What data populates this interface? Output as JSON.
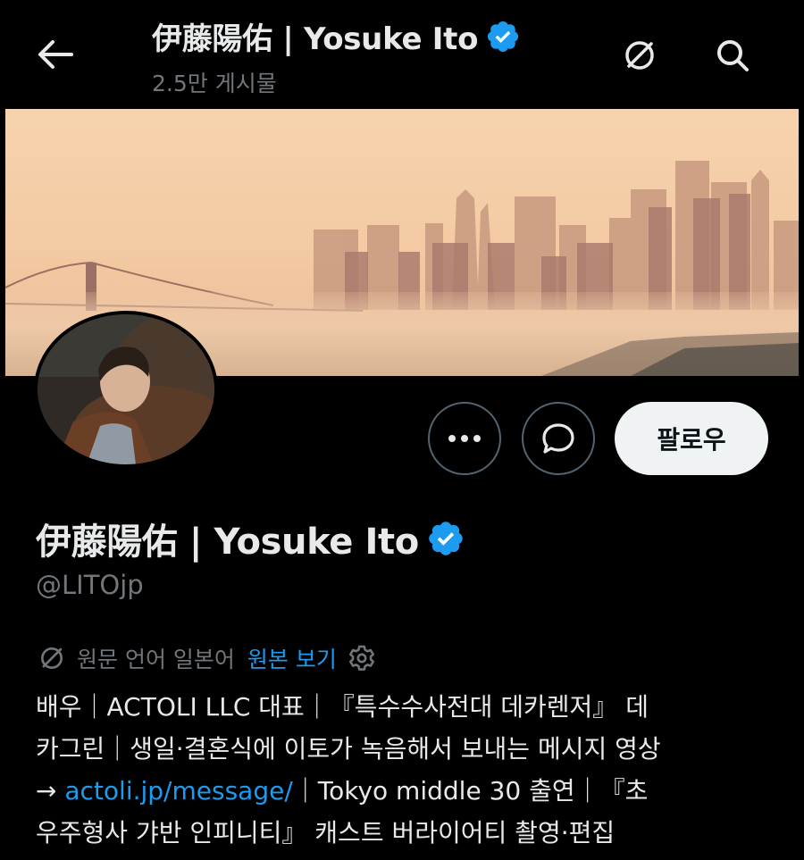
{
  "header": {
    "title": "伊藤陽佑 | Yosuke Ito",
    "subtitle": "2.5만 게시물"
  },
  "profile": {
    "name": "伊藤陽佑 | Yosuke Ito",
    "handle": "@LITOjp",
    "follow_label": "팔로우"
  },
  "translation": {
    "source_text": "원문 언어 일본어",
    "show_original": "원본 보기"
  },
  "bio": {
    "line1": "배우｜ACTOLI LLC 대표｜『특수수사전대 데카렌저』 데",
    "line2": "카그린｜생일·결혼식에 이토가 녹음해서 보내는 메시지 영상",
    "line3_arrow": "→ ",
    "line3_link": "actoli.jp/message/",
    "line3_rest": "｜Tokyo middle 30 출연｜『초",
    "line4": "우주형사 갸반 인피니티』 캐스트 버라이어티 촬영·편집"
  },
  "colors": {
    "background": "#000000",
    "accent": "#1d9bf0",
    "text_primary": "#e7e9ea",
    "text_secondary": "#71767b"
  },
  "icons": [
    "back-arrow-icon",
    "verified-badge-icon",
    "translate-icon",
    "search-icon",
    "more-icon",
    "message-icon",
    "gear-icon"
  ]
}
